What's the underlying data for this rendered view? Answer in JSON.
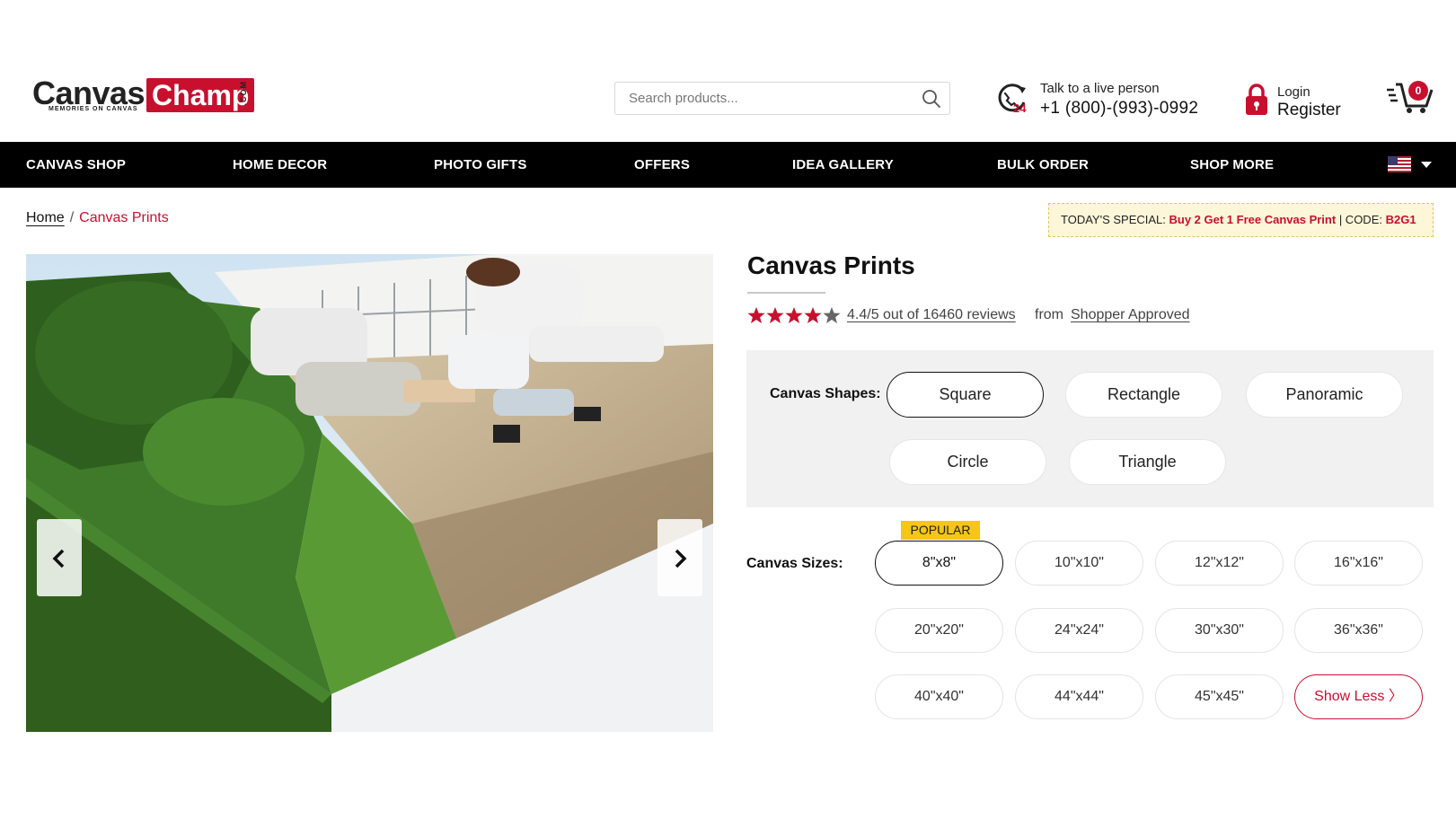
{
  "header": {
    "logo": {
      "wordmark_dark": "Canvas",
      "wordmark_red": "Champ",
      "suffix": ".COM",
      "tagline": "MEMORIES ON CANVAS"
    },
    "search": {
      "placeholder": "Search products..."
    },
    "phone": {
      "label": "Talk to a live person",
      "number": "+1 (800)-(993)-0992",
      "icon_badge": "24"
    },
    "account": {
      "login": "Login",
      "register": "Register"
    },
    "cart": {
      "count": "0"
    }
  },
  "nav": {
    "items": [
      "CANVAS SHOP",
      "HOME DECOR",
      "PHOTO GIFTS",
      "OFFERS",
      "IDEA GALLERY",
      "BULK ORDER",
      "SHOP MORE"
    ],
    "locale_icon": "us-flag-icon"
  },
  "breadcrumb": {
    "home": "Home",
    "separator": "/",
    "current": "Canvas Prints"
  },
  "special_offer": {
    "prefix": "TODAY'S SPECIAL:",
    "offer": "Buy 2 Get 1 Free Canvas Print",
    "code_label": "| CODE:",
    "code": "B2G1"
  },
  "product": {
    "title": "Canvas Prints",
    "rating": {
      "stars": 4.4,
      "text": "4.4/5 out of 16460 reviews",
      "from": "from",
      "source": "Shopper Approved"
    },
    "shapes": {
      "label": "Canvas Shapes:",
      "options": [
        "Square",
        "Rectangle",
        "Panoramic",
        "Circle",
        "Triangle"
      ],
      "selected": "Square"
    },
    "sizes": {
      "label": "Canvas Sizes:",
      "popular_badge": "POPULAR",
      "options": [
        "8\"x8\"",
        "10\"x10\"",
        "12\"x12\"",
        "16\"x16\"",
        "20\"x20\"",
        "24\"x24\"",
        "30\"x30\"",
        "36\"x36\"",
        "40\"x40\"",
        "44\"x44\"",
        "45\"x45\""
      ],
      "selected": "8\"x8\"",
      "toggle_label": "Show Less 〉"
    }
  },
  "colors": {
    "brand_red": "#c8102e",
    "nav_bg": "#000000",
    "popular_badge": "#f5c518",
    "special_bg": "#fdf6d9"
  }
}
